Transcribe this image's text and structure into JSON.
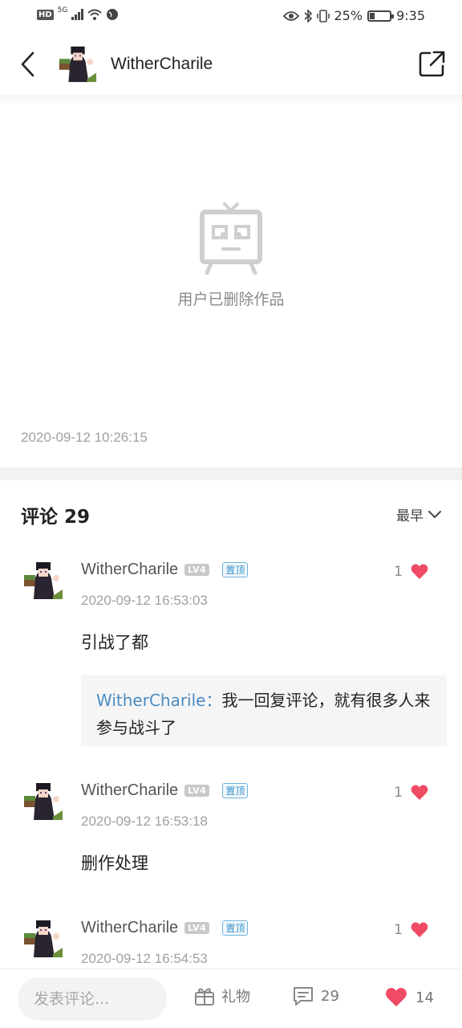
{
  "status_bar": {
    "left_badge": "HD",
    "network": "5G",
    "battery": "25%",
    "battery_level": 0.25,
    "time": "9:35"
  },
  "header": {
    "username": "WitherCharile"
  },
  "post": {
    "deleted_message": "用户已删除作品",
    "timestamp": "2020-09-12 10:26:15"
  },
  "comments_section": {
    "title": "评论 29",
    "sort_label": "最早",
    "comments": [
      {
        "username": "WitherCharile",
        "level": "LV4",
        "pin_label": "置顶",
        "like_count": "1",
        "time": "2020-09-12 16:53:03",
        "text": "引战了都",
        "reply": {
          "user": "WitherCharile：",
          "text": "我一回复评论，就有很多人来参与战斗了"
        }
      },
      {
        "username": "WitherCharile",
        "level": "LV4",
        "pin_label": "置顶",
        "like_count": "1",
        "time": "2020-09-12 16:53:18",
        "text": "删作处理"
      },
      {
        "username": "WitherCharile",
        "level": "LV4",
        "pin_label": "置顶",
        "like_count": "1",
        "time": "2020-09-12 16:54:53",
        "text": ""
      }
    ]
  },
  "bottom_bar": {
    "input_placeholder": "发表评论...",
    "gift_label": "礼物",
    "comment_count": "29",
    "like_count": "14"
  },
  "colors": {
    "heart": "#f04b64",
    "pin_badge": "#3a92c8",
    "reply_user": "#4a8cc4"
  }
}
